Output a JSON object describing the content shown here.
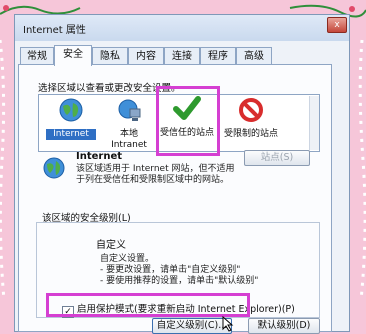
{
  "window": {
    "title": "Internet 属性",
    "close_glyph": "x"
  },
  "tabs": [
    {
      "label": "常规"
    },
    {
      "label": "安全",
      "active": true
    },
    {
      "label": "隐私"
    },
    {
      "label": "内容"
    },
    {
      "label": "连接"
    },
    {
      "label": "程序"
    },
    {
      "label": "高级"
    }
  ],
  "security": {
    "zone_prompt": "选择区域以查看或更改安全设置。",
    "zones": [
      {
        "label": "Internet",
        "icon": "globe-icon"
      },
      {
        "label": "本地 Intranet",
        "icon": "local-intranet-icon"
      },
      {
        "label": "受信任的站点",
        "icon": "green-check-icon"
      },
      {
        "label": "受限制的站点",
        "icon": "red-prohibited-icon"
      }
    ],
    "info": {
      "title": "Internet",
      "description": "该区域适用于 Internet 网站，但不适用于列在受信任和受限制区域中的网站。"
    },
    "sites_button": "站点(S)",
    "level_group_label": "该区域的安全级别(L)",
    "level_title": "自定义",
    "level_bullets": [
      "自定义设置。",
      "- 要更改设置，请单击\"自定义级别\"",
      "- 要使用推荐的设置，请单击\"默认级别\""
    ],
    "protected_mode": {
      "label": "启用保护模式(要求重新启动 Internet Explorer)(P)",
      "checked": true
    },
    "custom_level_button": "自定义级别(C)...",
    "default_level_button": "默认级别(D)"
  },
  "colors": {
    "highlight": "#d53fd2",
    "background": "#f6c6d9",
    "decor": "#2f8f3a"
  }
}
